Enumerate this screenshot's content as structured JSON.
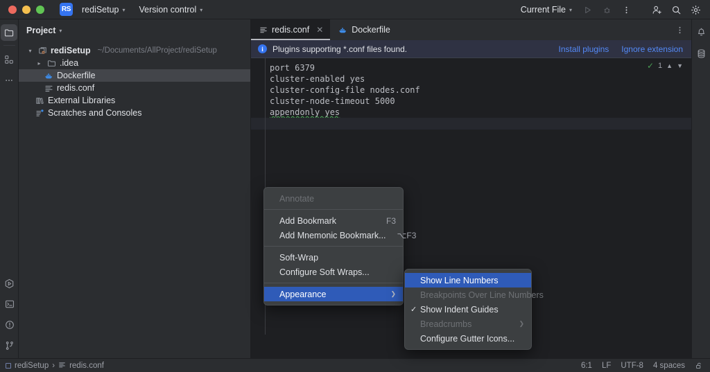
{
  "titlebar": {
    "project_badge": "RS",
    "project_name": "rediSetup",
    "version_control": "Version control",
    "run_config": "Current File",
    "icons": {
      "run": "run-icon",
      "debug": "debug-icon",
      "more": "more-options-icon",
      "account": "account-icon",
      "search": "search-icon",
      "settings": "settings-gear-icon"
    }
  },
  "left_rail": {
    "project_icon": "project-folder-icon",
    "structure_icon": "structure-icon",
    "more_icon": "more-tool-windows-icon",
    "run_icon": "run-tool-icon",
    "terminal_icon": "terminal-icon",
    "problems_icon": "problems-warning-icon",
    "vcs_icon": "version-control-branch-icon"
  },
  "right_rail": {
    "notifications_icon": "notifications-bell-icon",
    "database_icon": "database-icon"
  },
  "project_panel": {
    "title": "Project",
    "tree": [
      {
        "label": "rediSetup",
        "path": "~/Documents/AllProject/rediSetup",
        "icon": "module-icon",
        "twisty": "expanded",
        "indent": 0,
        "selected": false,
        "bold": true
      },
      {
        "label": ".idea",
        "path": "",
        "icon": "folder-icon",
        "twisty": "collapsed",
        "indent": 1,
        "selected": false,
        "bold": false
      },
      {
        "label": "Dockerfile",
        "path": "",
        "icon": "docker-icon",
        "twisty": "none",
        "indent": 2,
        "selected": true,
        "bold": false
      },
      {
        "label": "redis.conf",
        "path": "",
        "icon": "conf-file-icon",
        "twisty": "none",
        "indent": 2,
        "selected": false,
        "bold": false
      },
      {
        "label": "External Libraries",
        "path": "",
        "icon": "libraries-icon",
        "twisty": "none",
        "indent": 1,
        "selected": false,
        "bold": false
      },
      {
        "label": "Scratches and Consoles",
        "path": "",
        "icon": "scratches-icon",
        "twisty": "none",
        "indent": 1,
        "selected": false,
        "bold": false
      }
    ]
  },
  "editor": {
    "tabs": [
      {
        "label": "redis.conf",
        "icon": "conf-file-icon",
        "active": true,
        "closable": true
      },
      {
        "label": "Dockerfile",
        "icon": "docker-icon",
        "active": false,
        "closable": false
      }
    ],
    "notification": {
      "message": "Plugins supporting *.conf files found.",
      "install_label": "Install plugins",
      "ignore_label": "Ignore extension"
    },
    "inspection": {
      "count": "1",
      "ok_icon": "inspection-ok-icon",
      "prev_icon": "previous-problem-icon",
      "next_icon": "next-problem-icon"
    },
    "lines": [
      "port 6379",
      "cluster-enabled yes",
      "cluster-config-file nodes.conf",
      "cluster-node-timeout 5000",
      "appendonly yes"
    ]
  },
  "context_menu": {
    "items": [
      {
        "label": "Annotate",
        "shortcut": "",
        "state": "disabled",
        "type": "item"
      },
      {
        "type": "separator"
      },
      {
        "label": "Add Bookmark",
        "shortcut": "F3",
        "state": "normal",
        "type": "item"
      },
      {
        "label": "Add Mnemonic Bookmark...",
        "shortcut": "⌥F3",
        "state": "normal",
        "type": "item"
      },
      {
        "type": "separator"
      },
      {
        "label": "Soft-Wrap",
        "shortcut": "",
        "state": "normal",
        "type": "item"
      },
      {
        "label": "Configure Soft Wraps...",
        "shortcut": "",
        "state": "normal",
        "type": "item"
      },
      {
        "type": "separator"
      },
      {
        "label": "Appearance",
        "shortcut": "",
        "state": "highlighted",
        "type": "submenu"
      }
    ]
  },
  "submenu": {
    "items": [
      {
        "label": "Show Line Numbers",
        "state": "highlighted",
        "checked": false,
        "type": "item"
      },
      {
        "label": "Breakpoints Over Line Numbers",
        "state": "disabled",
        "checked": false,
        "type": "item"
      },
      {
        "label": "Show Indent Guides",
        "state": "normal",
        "checked": true,
        "type": "item"
      },
      {
        "label": "Breadcrumbs",
        "state": "disabled",
        "checked": false,
        "type": "submenu"
      },
      {
        "label": "Configure Gutter Icons...",
        "state": "normal",
        "checked": false,
        "type": "item"
      }
    ]
  },
  "statusbar": {
    "breadcrumb_project": "rediSetup",
    "breadcrumb_separator": "›",
    "breadcrumb_file": "redis.conf",
    "caret": "6:1",
    "line_sep": "LF",
    "encoding": "UTF-8",
    "indent": "4 spaces",
    "lock_icon": "unlocked-readonly-icon"
  }
}
